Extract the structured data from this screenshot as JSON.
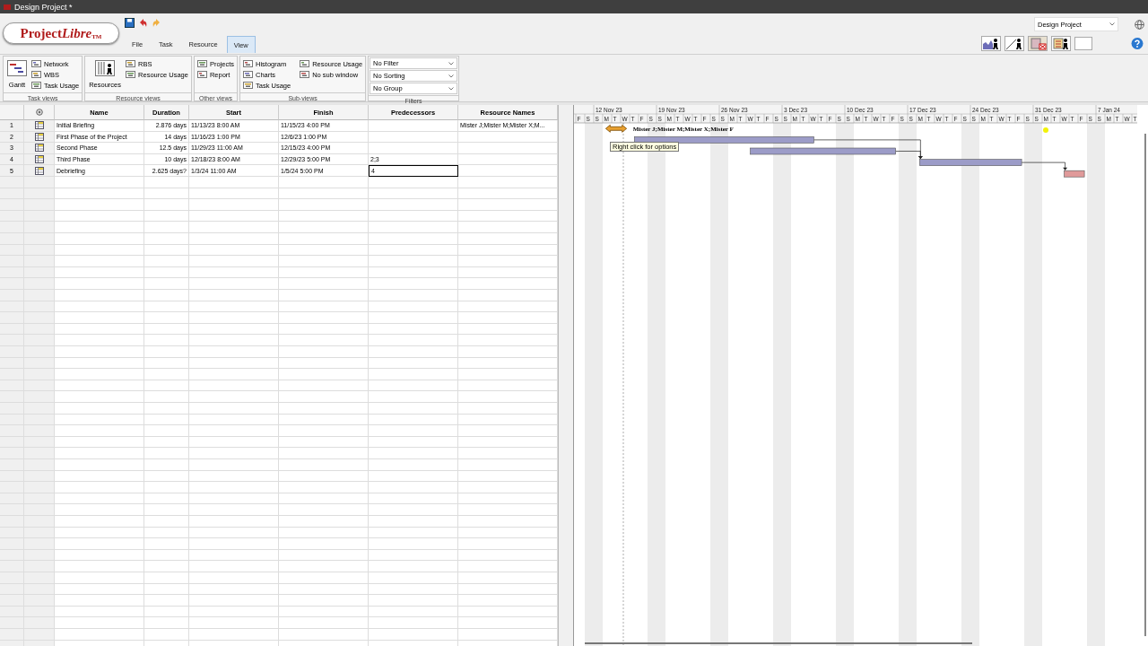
{
  "window": {
    "title": "Design Project *"
  },
  "logo": {
    "main": "Project",
    "accent": "Libre",
    "mark": "TM"
  },
  "menu_tabs": [
    {
      "label": "File",
      "selected": false
    },
    {
      "label": "Task",
      "selected": false
    },
    {
      "label": "Resource",
      "selected": false
    },
    {
      "label": "View",
      "selected": true
    }
  ],
  "project_selector": {
    "value": "Design Project"
  },
  "ribbon": {
    "groups": [
      {
        "label": "Task views",
        "large": "Gantt",
        "items": [
          "Network",
          "WBS",
          "Task Usage"
        ]
      },
      {
        "label": "Resource views",
        "large": "Resources",
        "items": [
          "RBS",
          "Resource Usage"
        ]
      },
      {
        "label": "Other views",
        "items": [
          "Projects",
          "Report"
        ]
      },
      {
        "label": "Sub-views",
        "items": [
          "Histogram",
          "Charts",
          "Task Usage",
          "Resource Usage",
          "No sub window"
        ]
      }
    ],
    "filters": {
      "label": "Filters",
      "dropdowns": [
        "No Filter",
        "No Sorting",
        "No Group"
      ]
    }
  },
  "table": {
    "columns": [
      "Name",
      "Duration",
      "Start",
      "Finish",
      "Predecessors",
      "Resource Names"
    ],
    "rows": [
      {
        "id": "1",
        "name": "Initial Briefing",
        "duration": "2.876 days",
        "start": "11/13/23 8:00 AM",
        "finish": "11/15/23 4:00 PM",
        "predecessors": "",
        "resource_names": "Mister J;Mister M;Mister X;M...",
        "editing": false,
        "color": "#e8a030",
        "kind": "handle",
        "bar_label": "Mister J;Mister M;Mister X;Mister F"
      },
      {
        "id": "2",
        "name": "First Phase of the Project",
        "duration": "14 days",
        "start": "11/16/23 1:00 PM",
        "finish": "12/6/23 1:00 PM",
        "predecessors": "",
        "resource_names": "",
        "editing": false,
        "color": "#9c9cc8",
        "kind": "bar"
      },
      {
        "id": "3",
        "name": "Second Phase",
        "duration": "12.5 days",
        "start": "11/29/23 11:00 AM",
        "finish": "12/15/23 4:00 PM",
        "predecessors": "",
        "resource_names": "",
        "editing": false,
        "color": "#9c9cc8",
        "kind": "bar"
      },
      {
        "id": "4",
        "name": "Third Phase",
        "duration": "10 days",
        "start": "12/18/23 8:00 AM",
        "finish": "12/29/23 5:00 PM",
        "predecessors": "2;3",
        "resource_names": "",
        "editing": false,
        "color": "#9c9cc8",
        "kind": "bar"
      },
      {
        "id": "5",
        "name": "Debriefing",
        "duration": "2.625 days?",
        "start": "1/3/24 11:00 AM",
        "finish": "1/5/24 5:00 PM",
        "predecessors": "4",
        "resource_names": "",
        "editing": true,
        "color": "#e09a9a",
        "kind": "bar"
      }
    ]
  },
  "gantt": {
    "weeks": [
      "12 Nov 23",
      "19 Nov 23",
      "26 Nov 23",
      "3 Dec 23",
      "10 Dec 23",
      "17 Dec 23",
      "24 Dec 23",
      "31 Dec 23",
      "7 Jan 24"
    ],
    "day_letters": [
      "F",
      "S",
      "S",
      "M",
      "T",
      "W",
      "T",
      "F",
      "S",
      "S",
      "M",
      "T",
      "W",
      "T",
      "F",
      "S",
      "S",
      "M",
      "T",
      "W",
      "T",
      "F",
      "S",
      "S",
      "M",
      "T",
      "W",
      "T",
      "F",
      "S",
      "S",
      "M",
      "T",
      "W",
      "T",
      "F",
      "S",
      "S",
      "M",
      "T",
      "W",
      "T",
      "F",
      "S",
      "S",
      "M",
      "T",
      "W",
      "T",
      "F",
      "S",
      "S",
      "M",
      "T",
      "W",
      "T",
      "F",
      "S",
      "S",
      "M",
      "T",
      "W",
      "T"
    ],
    "tooltip": "Right click for options"
  }
}
